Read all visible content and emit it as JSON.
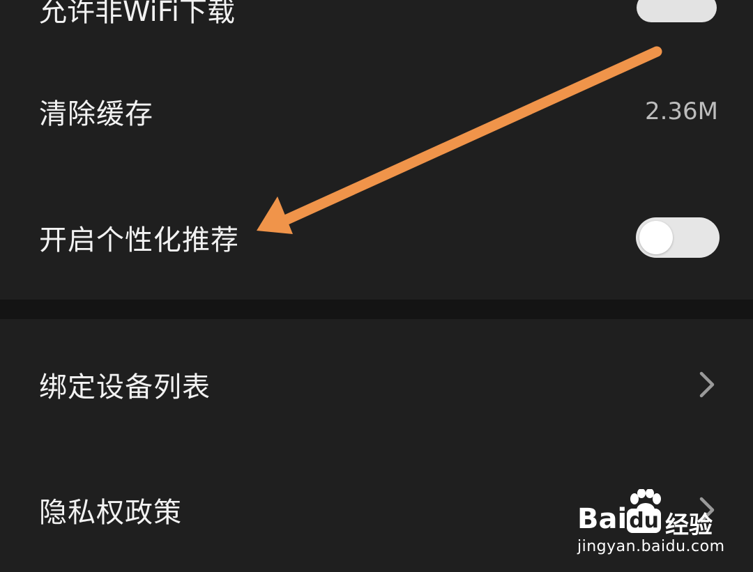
{
  "settings": {
    "partial_row": {
      "label": "允许非WiFi下载"
    },
    "clear_cache": {
      "label": "清除缓存",
      "value": "2.36M"
    },
    "personalized": {
      "label": "开启个性化推荐",
      "toggle_on": false
    },
    "bound_devices": {
      "label": "绑定设备列表"
    },
    "privacy_policy": {
      "label": "隐私权政策"
    }
  },
  "watermark": {
    "brand_prefix": "Bai",
    "brand_du": "du",
    "brand_cn": "经验",
    "url": "jingyan.baidu.com"
  },
  "colors": {
    "background": "#1f1f1f",
    "separator": "#141414",
    "arrow": "#f0944a",
    "text": "#f2f2f2",
    "value_text": "#bdbdbd"
  },
  "icons": {
    "chevron": "chevron-right-icon",
    "annotation": "arrow-annotation-icon"
  }
}
